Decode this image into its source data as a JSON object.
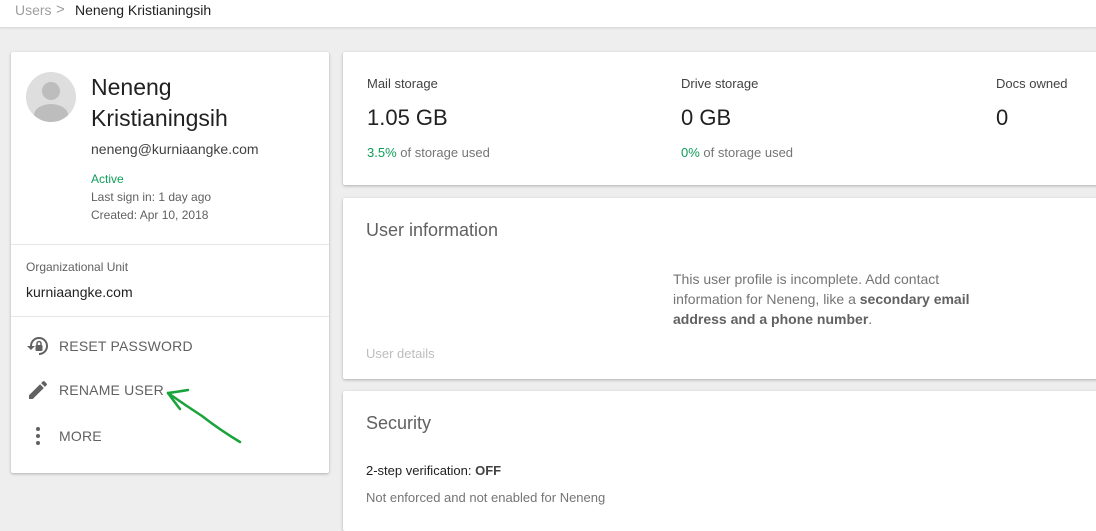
{
  "breadcrumb": {
    "users": "Users",
    "separator": ">",
    "current": "Neneng Kristianingsih"
  },
  "user": {
    "name": "Neneng Kristianingsih",
    "email": "neneng@kurniaangke.com",
    "status": "Active",
    "last_sign_in": "Last sign in: 1 day ago",
    "created": "Created: Apr 10, 2018",
    "org_unit_label": "Organizational Unit",
    "org_unit_value": "kurniaangke.com",
    "actions": {
      "reset_password": "RESET PASSWORD",
      "rename_user": "RENAME USER",
      "more": "MORE"
    }
  },
  "storage": {
    "mail": {
      "label": "Mail storage",
      "value": "1.05 GB",
      "pct": "3.5%",
      "suffix": " of storage used"
    },
    "drive": {
      "label": "Drive storage",
      "value": "0 GB",
      "pct": "0%",
      "suffix": " of storage used"
    },
    "docs": {
      "label": "Docs owned",
      "value": "0"
    }
  },
  "user_information": {
    "title": "User information",
    "text_prefix": "This user profile is incomplete. Add contact information for Neneng, like a ",
    "text_bold": "secondary email address and a phone number",
    "text_suffix": ".",
    "details_link": "User details"
  },
  "security": {
    "title": "Security",
    "two_step_label": "2-step verification: ",
    "two_step_status": "OFF",
    "not_enforced": "Not enforced and not enabled for Neneng"
  },
  "colors": {
    "accent_green": "#0f9d58",
    "annotation_arrow": "#1aa33a"
  }
}
